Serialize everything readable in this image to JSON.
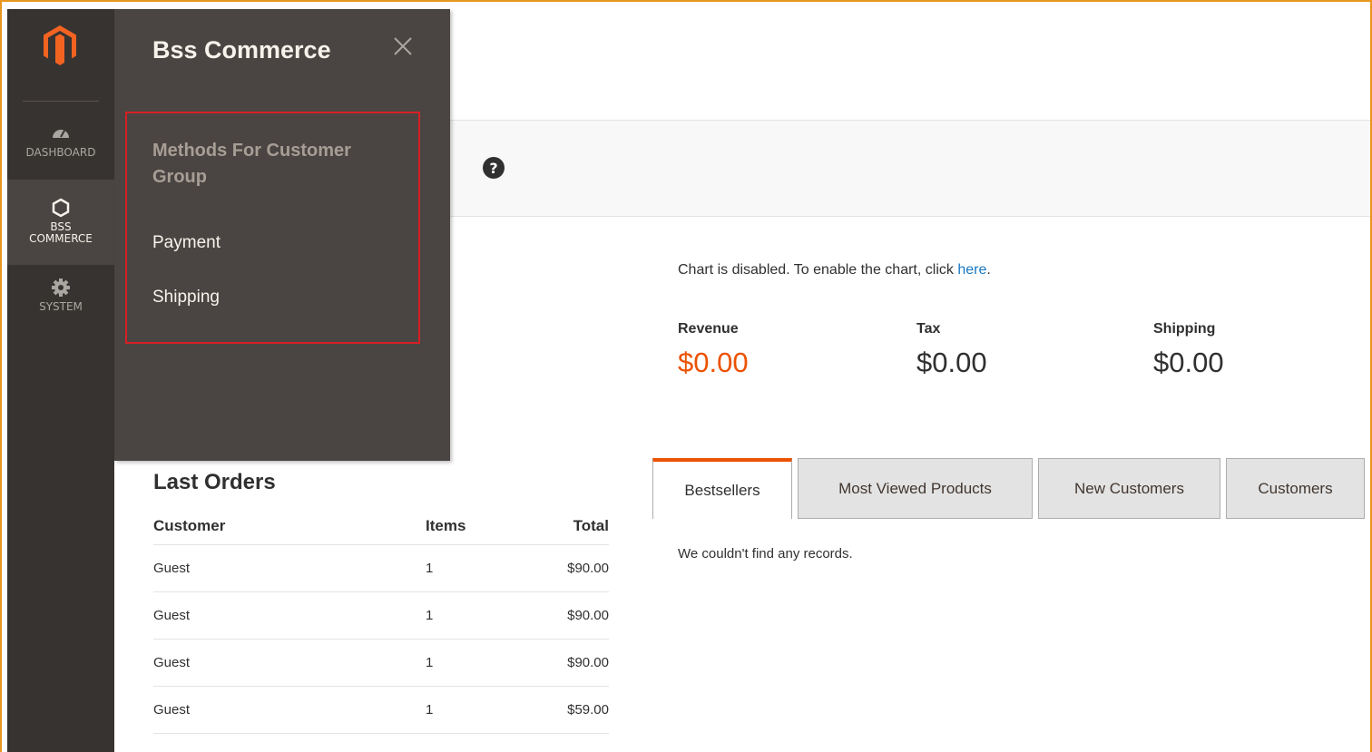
{
  "nav": {
    "items": [
      {
        "label": "DASHBOARD",
        "icon": "dashboard-icon"
      },
      {
        "label_line1": "BSS",
        "label_line2": "COMMERCE",
        "icon": "hexagon-icon"
      },
      {
        "label": "SYSTEM",
        "icon": "gear-icon"
      }
    ],
    "logo_icon": "magento-logo",
    "colors": {
      "background": "#373330",
      "active": "#4a4542"
    }
  },
  "flyout": {
    "title": "Bss Commerce",
    "close_icon": "close-icon",
    "group_title": "Methods For Customer Group",
    "links": [
      "Payment",
      "Shipping"
    ],
    "highlight_color": "#d71f25"
  },
  "page_bar": {
    "help_icon": "help-icon"
  },
  "chart": {
    "message": "Chart is disabled. To enable the chart, click ",
    "link": "here",
    "message_end": "."
  },
  "totals": [
    {
      "label": "Revenue",
      "value": "$0.00",
      "color": "#eb5202"
    },
    {
      "label": "Tax",
      "value": "$0.00"
    },
    {
      "label": "Shipping",
      "value": "$0.00"
    }
  ],
  "last_orders": {
    "title": "Last Orders",
    "headers": {
      "customer": "Customer",
      "items": "Items",
      "total": "Total"
    },
    "rows": [
      {
        "customer": "Guest",
        "items": "1",
        "total": "$90.00"
      },
      {
        "customer": "Guest",
        "items": "1",
        "total": "$90.00"
      },
      {
        "customer": "Guest",
        "items": "1",
        "total": "$90.00"
      },
      {
        "customer": "Guest",
        "items": "1",
        "total": "$59.00"
      }
    ]
  },
  "tabs": {
    "items": [
      "Bestsellers",
      "Most Viewed Products",
      "New Customers",
      "Customers"
    ],
    "active": "Bestsellers",
    "empty_message": "We couldn't find any records."
  },
  "accent_color": "#eb5202"
}
